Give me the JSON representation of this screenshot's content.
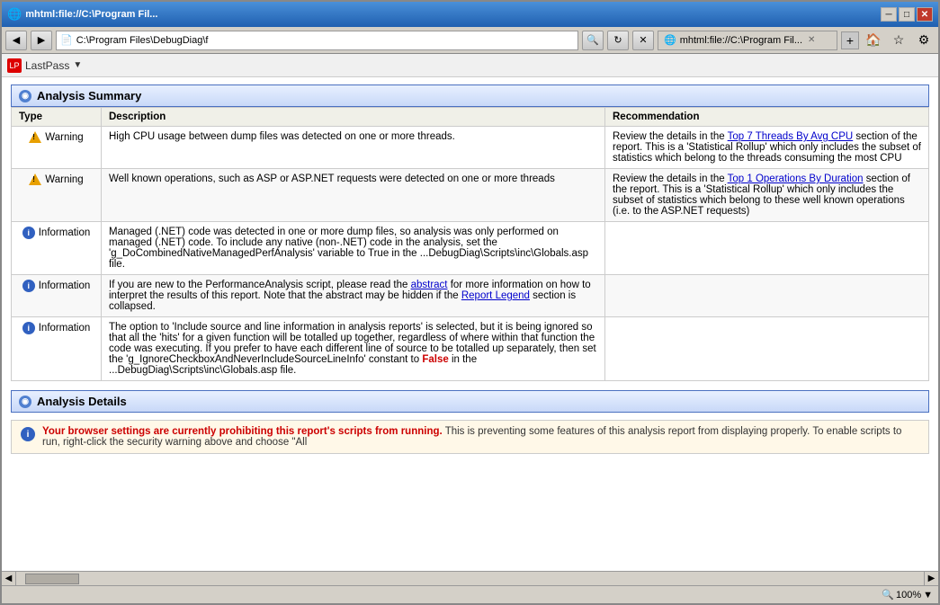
{
  "window": {
    "title": "mhtml:file://C:\\Program Files...",
    "title_bar_title": "mhtml:file://C:\\Program Fil..."
  },
  "address_bar": {
    "url1": "C:\\Program Files\\DebugDiag\\f",
    "url2": "mhtml:file://C:\\Program Fil...",
    "tab_label": "mhtml:file://C:\\Program Fil..."
  },
  "lastpass": {
    "label": "LastPass",
    "arrow": "▼"
  },
  "analysis_summary": {
    "section_title": "Analysis Summary",
    "col_type": "Type",
    "col_description": "Description",
    "col_recommendation": "Recommendation",
    "rows": [
      {
        "type_icon": "warning",
        "type_label": "Warning",
        "description": "High CPU usage between dump files was detected on one or more threads.",
        "recommendation_prefix": "Review the details in the ",
        "recommendation_link1_text": "Top 7 Threads By Avg CPU",
        "recommendation_link1_href": "#",
        "recommendation_suffix": " section of the report. This is a 'Statistical Rollup' which only includes the subset of statistics which belong to the threads consuming the most CPU"
      },
      {
        "type_icon": "warning",
        "type_label": "Warning",
        "description": "Well known operations, such as ASP or ASP.NET requests were detected on one or more threads",
        "recommendation_prefix": "Review the details in the ",
        "recommendation_link1_text": "Top 1 Operations By Duration",
        "recommendation_link1_href": "#",
        "recommendation_suffix": " section of the report. This is a 'Statistical Rollup' which only includes the subset of statistics which belong to these well known operations (i.e. to the ASP.NET requests)"
      },
      {
        "type_icon": "info",
        "type_label": "Information",
        "description": "Managed (.NET) code was detected in one or more dump files, so analysis was only performed on managed (.NET) code. To include any native (non-.NET) code in the analysis, set the 'g_DoCombinedNativeManagedPerfAnalysis' variable to True in the ...DebugDiag\\Scripts\\inc\\Globals.asp file.",
        "recommendation": ""
      },
      {
        "type_icon": "info",
        "type_label": "Information",
        "description_prefix": "If you are new to the PerformanceAnalysis script, please read the ",
        "description_link1_text": "abstract",
        "description_link1_href": "#",
        "description_suffix": " for more information on how to interpret the results of this report.   Note that the abstract may be hidden if the ",
        "description_link2_text": "Report Legend",
        "description_link2_href": "#",
        "description_suffix2": " section is collapsed.",
        "recommendation": ""
      },
      {
        "type_icon": "info",
        "type_label": "Information",
        "description_prefix": "The option to 'Include source and line information in analysis reports' is selected, but it is being ignored so that all the 'hits' for a given function will be totalled up together, regardless of where within that function the code was executing. If you prefer to have each different line of source to be totalled up separately, then set the 'g_IgnoreCheckboxAndNeverIncludeSourceLineInfo' constant to ",
        "description_highlight_false": "False",
        "description_suffix": " in the ...DebugDiag\\Scripts\\inc\\Globals.asp file.",
        "recommendation": ""
      }
    ]
  },
  "analysis_details": {
    "section_title": "Analysis Details",
    "info_banner_bold": "Your browser settings are currently prohibiting this report's scripts from running.",
    "info_banner_text": " This is preventing some features of this analysis report from displaying properly. To enable scripts to run, right-click the security warning above and choose \"All"
  },
  "status_bar": {
    "zoom_label": "100%",
    "zoom_arrow": "▼"
  }
}
